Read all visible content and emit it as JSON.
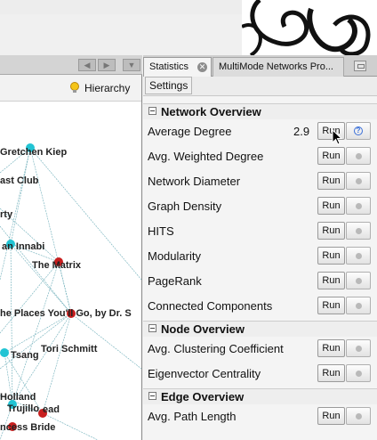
{
  "left_pane": {
    "hierarchy_label": "Hierarchy",
    "node_labels": [
      "Gretchen Kiep",
      "ast Club",
      "rty",
      "an Innabi",
      "The Matrix",
      "he Places You'll Go, by Dr. S",
      "Tori Schmitt",
      "Tsang",
      "Holland",
      "Trujillo",
      "ncess Bride",
      "ead"
    ]
  },
  "tabs": {
    "statistics": "Statistics",
    "multimode": "MultiMode Networks Pro..."
  },
  "toolbar": {
    "settings_label": "Settings"
  },
  "run_label": "Run",
  "sections": {
    "network": {
      "title": "Network Overview",
      "rows": [
        {
          "label": "Average Degree",
          "value": "2.9"
        },
        {
          "label": "Avg. Weighted Degree"
        },
        {
          "label": "Network Diameter"
        },
        {
          "label": "Graph Density"
        },
        {
          "label": "HITS"
        },
        {
          "label": "Modularity"
        },
        {
          "label": "PageRank"
        },
        {
          "label": "Connected Components"
        }
      ]
    },
    "node": {
      "title": "Node Overview",
      "rows": [
        {
          "label": "Avg. Clustering Coefficient"
        },
        {
          "label": "Eigenvector Centrality"
        }
      ]
    },
    "edge": {
      "title": "Edge Overview",
      "rows": [
        {
          "label": "Avg. Path Length"
        }
      ]
    }
  },
  "colors": {
    "node_cyan": "#22c4d4",
    "node_red": "#c81e1e",
    "edge": "#4a9aa8"
  }
}
